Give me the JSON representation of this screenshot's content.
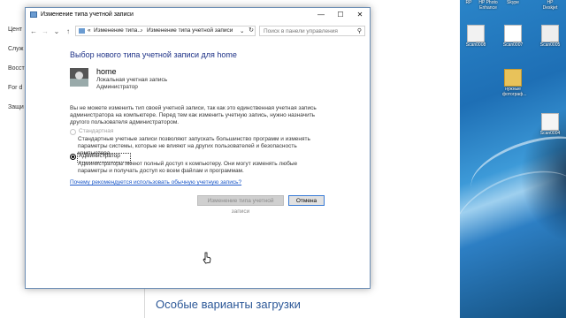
{
  "background_page": {
    "sidebar_items": [
      "Цент",
      "Служ",
      "Восст",
      "For d",
      "Защи"
    ],
    "bottom_heading": "Особые варианты загрузки"
  },
  "desktop": {
    "icons": [
      {
        "label": "RP",
        "name": "desktop-shortcut-icon"
      },
      {
        "label": "HP Photo Enhance",
        "name": "desktop-shortcut-icon"
      },
      {
        "label": "Skype",
        "name": "desktop-shortcut-icon"
      },
      {
        "label": "HP Deskjet",
        "name": "desktop-shortcut-icon"
      },
      {
        "label": "Scan0008",
        "name": "scan-file-icon"
      },
      {
        "label": "Scan0007",
        "name": "scan-file-icon"
      },
      {
        "label": "Scan0005",
        "name": "scan-file-icon"
      },
      {
        "label": "нужные фотограф...",
        "name": "folder-icon"
      },
      {
        "label": "Scan0004",
        "name": "scan-file-icon"
      }
    ]
  },
  "window": {
    "title": "Изменение типа учетной записи",
    "controls": {
      "minimize": "—",
      "maximize": "☐",
      "close": "✕"
    },
    "nav": {
      "back": "←",
      "forward": "→",
      "down": "⌄",
      "up": "↑"
    },
    "address": {
      "sep1": "«",
      "crumb1": "Изменение типа...",
      "sep2": "›",
      "crumb2": "Изменение типа учетной записи",
      "dropdown": "⌄",
      "refresh": "↻"
    },
    "search": {
      "placeholder": "Поиск в панели управления",
      "icon": "⚲"
    },
    "heading": "Выбор нового типа учетной записи для home",
    "user": {
      "name": "home",
      "line1": "Локальная учетная запись",
      "line2": "Администратор"
    },
    "info": "Вы не можете изменить тип своей учетной записи, так как это единственная учетная запись администратора на компьютере. Перед тем как изменить учетную запись, нужно назначить другого пользователя администратором.",
    "options": [
      {
        "label": "Стандартная",
        "desc": "Стандартные учетные записи позволяют запускать большинство программ и изменять параметры системы, которые не влияют на других пользователей и безопасность компьютера.",
        "selected": false,
        "disabled": true
      },
      {
        "label": "Администратор",
        "desc": "Администраторы имеют полный доступ к компьютеру. Они могут изменять любые параметры и получать доступ ко всем файлам и программам.",
        "selected": true,
        "disabled": false
      }
    ],
    "link": "Почему рекомендуется использовать обычную учетную запись?",
    "buttons": {
      "change": "Изменение типа учетной записи",
      "cancel": "Отмена"
    }
  }
}
